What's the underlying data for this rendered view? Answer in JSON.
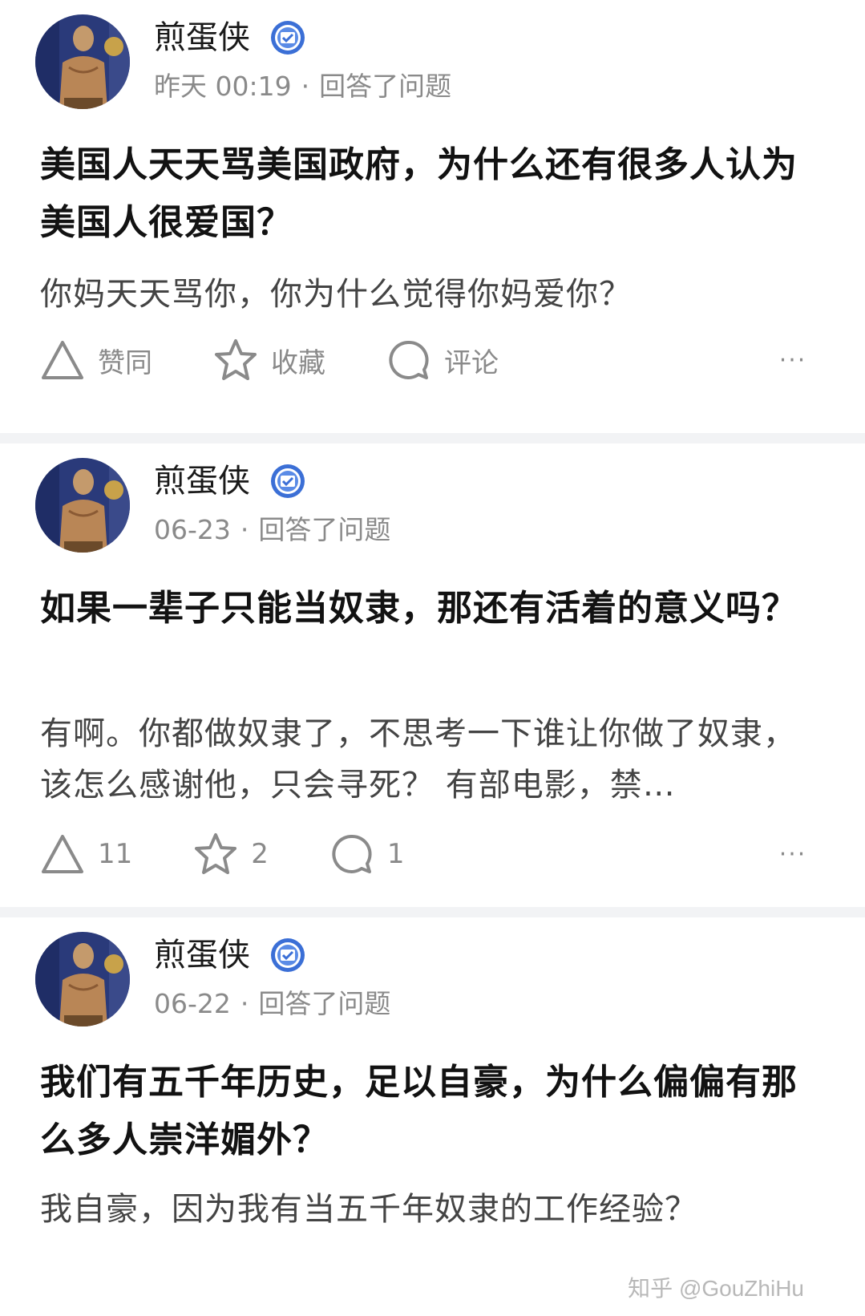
{
  "posts": [
    {
      "author": "煎蛋侠",
      "time": "昨天 00:19",
      "action": "回答了问题",
      "title": "美国人天天骂美国政府，为什么还有很多人认为美国人很爱国？",
      "excerpt": "你妈天天骂你，你为什么觉得你妈爱你？",
      "vote_label": "赞同",
      "collect_label": "收藏",
      "comment_label": "评论"
    },
    {
      "author": "煎蛋侠",
      "time": "06-23",
      "action": "回答了问题",
      "title": "如果一辈子只能当奴隶，那还有活着的意义吗？",
      "excerpt": "有啊。你都做奴隶了，不思考一下谁让你做了奴隶，该怎么感谢他，只会寻死？ 有部电影，禁…",
      "vote_label": "11",
      "collect_label": "2",
      "comment_label": "1"
    },
    {
      "author": "煎蛋侠",
      "time": "06-22",
      "action": "回答了问题",
      "title": "我们有五千年历史，足以自豪，为什么偏偏有那么多人崇洋媚外？",
      "excerpt": "我自豪，因为我有当五千年奴隶的工作经验？"
    }
  ],
  "separator_dot": "·",
  "more_label": "···",
  "watermark": "知乎 @GouZhiHu",
  "colors": {
    "badge": "#3b6fd6",
    "meta": "#8a8a8a",
    "separator": "#f2f3f5"
  },
  "icons": [
    "verified-badge-icon",
    "thumb-up-triangle-icon",
    "star-icon",
    "comment-bubble-icon",
    "more-dots-icon"
  ]
}
